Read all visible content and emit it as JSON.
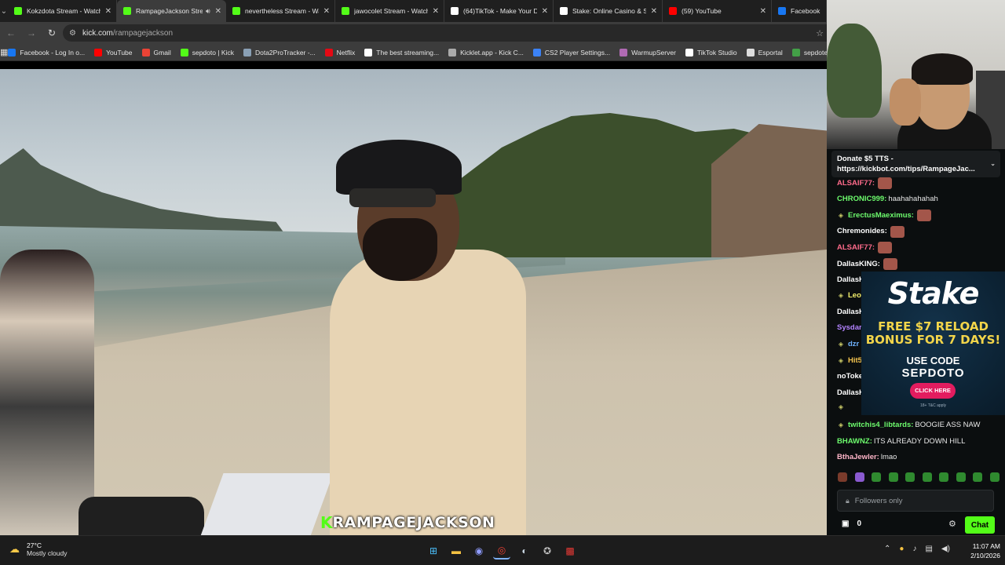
{
  "browser": {
    "tabs": [
      {
        "title": "Kokzdota Stream - Watch",
        "favicon": "kick-icon",
        "color": "#53fc18"
      },
      {
        "title": "RampageJackson Stre",
        "favicon": "kick-icon",
        "color": "#53fc18",
        "active": true
      },
      {
        "title": "nevertheless Stream - Wa",
        "favicon": "kick-icon",
        "color": "#53fc18"
      },
      {
        "title": "jawocolet Stream - Watch",
        "favicon": "kick-icon",
        "color": "#53fc18"
      },
      {
        "title": "(64)TikTok - Make Your D",
        "favicon": "tiktok-icon",
        "color": "#ffffff"
      },
      {
        "title": "Stake: Online Casino & Sp",
        "favicon": "stake-icon",
        "color": "#ffffff"
      },
      {
        "title": "(59) YouTube",
        "favicon": "youtube-icon",
        "color": "#ff0000"
      },
      {
        "title": "Facebook",
        "favicon": "facebook-icon",
        "color": "#1877f2"
      }
    ],
    "url_host": "kick.com",
    "url_path": "/rampagejackson",
    "bookmarks": [
      {
        "label": "Facebook - Log In o...",
        "color": "#1877f2"
      },
      {
        "label": "YouTube",
        "color": "#ff0000"
      },
      {
        "label": "Gmail",
        "color": "#ea4335"
      },
      {
        "label": "sepdoto | Kick",
        "color": "#53fc18"
      },
      {
        "label": "Dota2ProTracker -...",
        "color": "#8aa0b5"
      },
      {
        "label": "Netflix",
        "color": "#e50914"
      },
      {
        "label": "The best streaming...",
        "color": "#ffffff"
      },
      {
        "label": "Kicklet.app - Kick C...",
        "color": "#aaaaaa"
      },
      {
        "label": "CS2 Player Settings...",
        "color": "#3b82f6"
      },
      {
        "label": "WarmupServer",
        "color": "#b06ab3"
      },
      {
        "label": "TikTok Studio",
        "color": "#ffffff"
      },
      {
        "label": "Esportal",
        "color": "#dddddd"
      },
      {
        "label": "sepdotes | Weig",
        "color": "#43a047"
      }
    ]
  },
  "video": {
    "watermark_k": "K",
    "watermark_name": "RAMPAGEJACKSON"
  },
  "chat": {
    "pinned_line1": "Donate $5 TTS -",
    "pinned_line2": "https://kickbot.com/tips/RampageJac...",
    "messages": [
      {
        "user": "ALSAIF77:",
        "text": "",
        "color": "#ff6b8b",
        "emote": true,
        "badge": false
      },
      {
        "user": "CHRONIC999:",
        "text": "haahahahahah",
        "color": "#6dfb6d",
        "emote": false,
        "badge": false
      },
      {
        "user": "ErectusMaeximus:",
        "text": "",
        "color": "#6dfb6d",
        "emote": true,
        "badge": true
      },
      {
        "user": "Chremonides:",
        "text": "",
        "color": "#ffffff",
        "emote": true,
        "badge": false
      },
      {
        "user": "ALSAIF77:",
        "text": "",
        "color": "#ff6b8b",
        "emote": true,
        "badge": false
      },
      {
        "user": "DallasKING:",
        "text": "",
        "color": "#ffffff",
        "emote": true,
        "badge": false
      },
      {
        "user": "DallasK",
        "text": "",
        "color": "#ffffff",
        "emote": false,
        "badge": false
      },
      {
        "user": "Leo",
        "text": "",
        "color": "#f4f06b",
        "emote": false,
        "badge": true
      },
      {
        "user": "DallasK",
        "text": "",
        "color": "#ffffff",
        "emote": false,
        "badge": false
      },
      {
        "user": "Sysdar",
        "text": "",
        "color": "#b383ff",
        "emote": false,
        "badge": false
      },
      {
        "user": "dzr",
        "text": "",
        "color": "#6fb3ff",
        "emote": false,
        "badge": true
      },
      {
        "user": "Hit5",
        "text": "",
        "color": "#f4c44e",
        "emote": false,
        "badge": true
      },
      {
        "user": "noToke",
        "text": "",
        "color": "#ffffff",
        "emote": false,
        "badge": false
      },
      {
        "user": "DallasK",
        "text": "",
        "color": "#ffffff",
        "emote": false,
        "badge": false
      },
      {
        "user": "",
        "text": "",
        "color": "#ffffff",
        "emote": false,
        "badge": true
      },
      {
        "user": "twitchis4_libtards:",
        "text": "BOOGIE ASS NAW",
        "color": "#6dfb6d",
        "emote": false,
        "badge": true
      },
      {
        "user": "BHAWNZ:",
        "text": "ITS ALREADY DOWN HILL",
        "color": "#6dfb6d",
        "emote": false,
        "badge": false
      },
      {
        "user": "BthaJewler:",
        "text": "lmao",
        "color": "#ffb6c9",
        "emote": false,
        "badge": false
      }
    ],
    "input_placeholder": "Followers only",
    "points": "0",
    "chat_button": "Chat"
  },
  "promo": {
    "logo": "Stake",
    "line1": "FREE $7 RELOAD",
    "line2": "BONUS FOR 7 DAYS!",
    "line3": "USE CODE",
    "code": "SEPDOTO",
    "button": "CLICK HERE",
    "fine": "18+ T&C apply"
  },
  "taskbar": {
    "temperature": "27°C",
    "condition": "Mostly cloudy",
    "time": "11:07 AM",
    "date": "2/10/2026"
  }
}
